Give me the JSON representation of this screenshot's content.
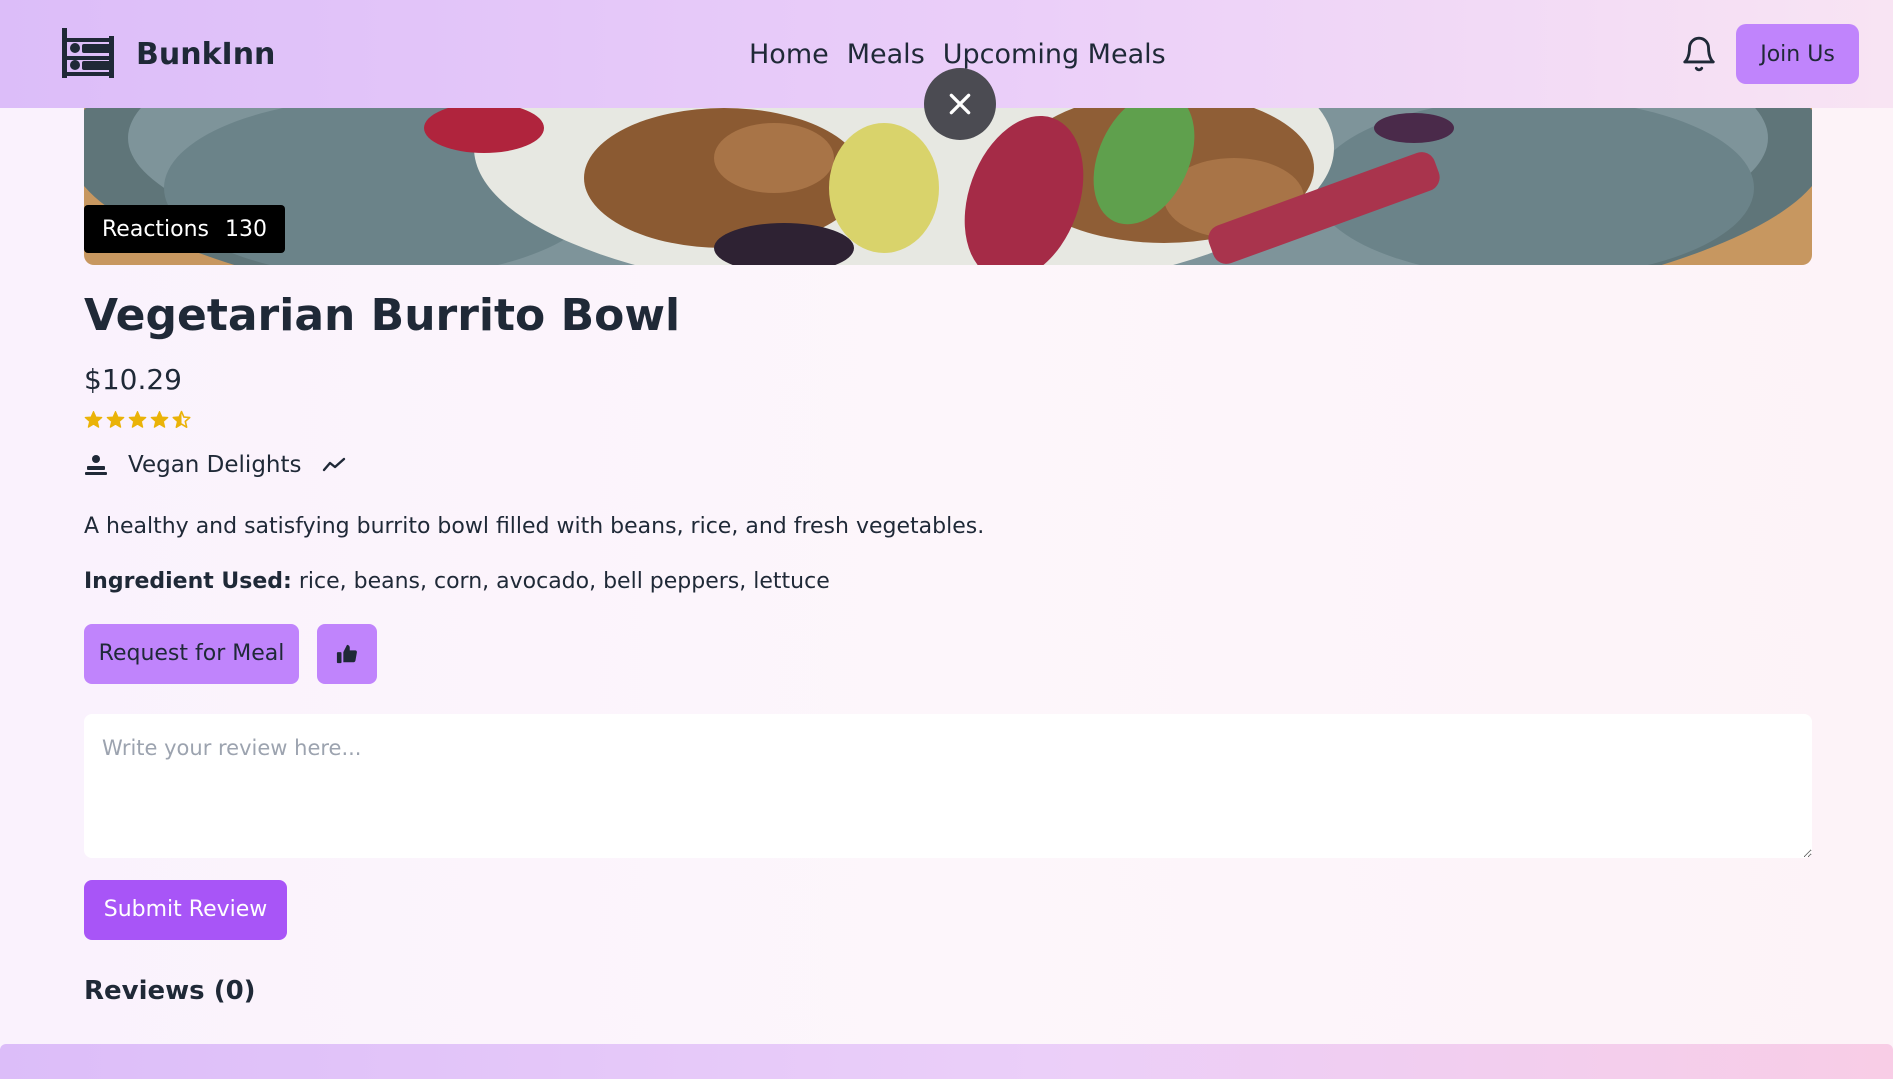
{
  "brand": {
    "name": "BunkInn",
    "logo_icon": "bunk-bed-icon"
  },
  "nav": {
    "links": [
      "Home",
      "Meals",
      "Upcoming Meals"
    ],
    "bell_icon": "bell-icon",
    "join_label": "Join Us"
  },
  "overlay": {
    "close_icon": "close-icon"
  },
  "meal": {
    "reactions_label": "Reactions",
    "reactions_count": "130",
    "title": "Vegetarian Burrito Bowl",
    "price": "$10.29",
    "rating": 4.5,
    "rating_max": 5,
    "distributor": "Vegan Delights",
    "distributor_icon": "chef-icon",
    "trend_icon": "trending-icon",
    "description": "A healthy and satisfying burrito bowl filled with beans, rice, and fresh vegetables.",
    "ingredients_label": "Ingredient Used:",
    "ingredients": "rice, beans, corn, avocado, bell peppers, lettuce"
  },
  "actions": {
    "request_label": "Request for Meal",
    "like_icon": "thumbs-up-icon"
  },
  "review": {
    "placeholder": "Write your review here...",
    "submit_label": "Submit Review",
    "heading": "Reviews (0)"
  },
  "colors": {
    "accent": "#c084fc",
    "accent_strong": "#a855f7",
    "text": "#1f2937",
    "star": "#eab308"
  }
}
